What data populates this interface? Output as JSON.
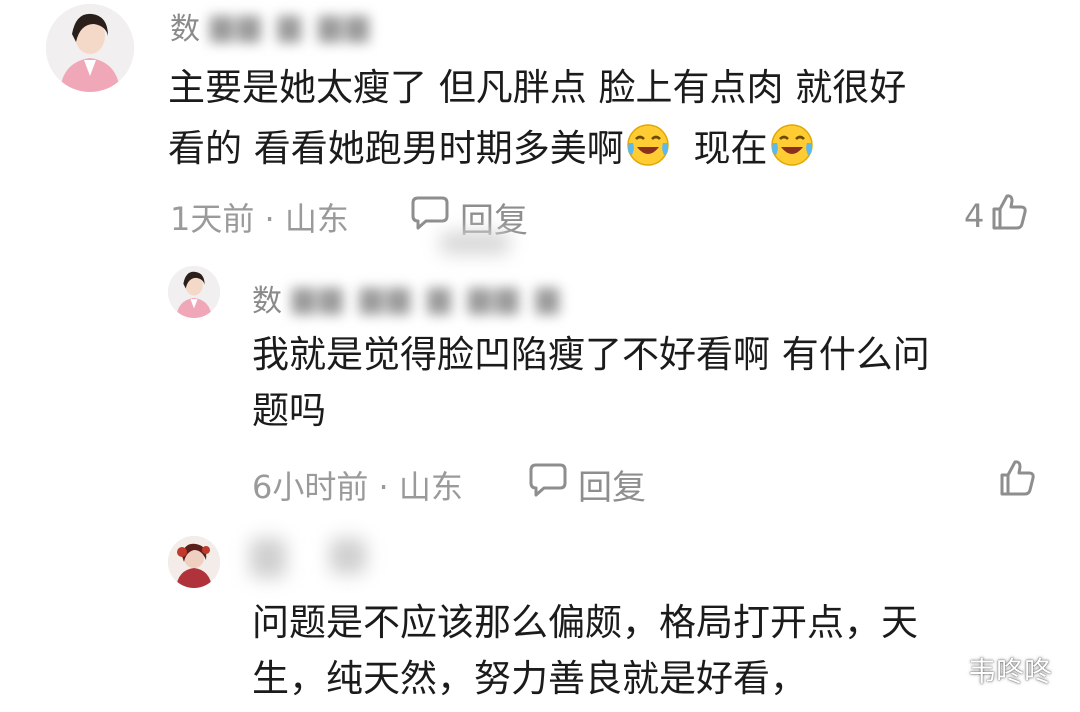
{
  "comments": [
    {
      "username_first_char": "数",
      "text_line1": "主要是她太瘦了 但凡胖点 脸上有点肉 就很好",
      "text_line2a": "看的 看看她跑男时期多美啊",
      "text_line2b": "现在",
      "meta": "1天前 · 山东",
      "reply_label": "回复",
      "like_count": "4"
    },
    {
      "username_first_char": "数",
      "text_line1": "我就是觉得脸凹陷瘦了不好看啊 有什么问",
      "text_line2": "题吗",
      "meta": "6小时前 · 山东",
      "reply_label": "回复",
      "like_count": ""
    },
    {
      "text_line1": "问题是不应该那么偏颇，格局打开点，天",
      "text_line2": "生，纯天然，努力善良就是好看，"
    }
  ],
  "watermark": {
    "text": "韦咚咚"
  },
  "icons": {
    "emoji": "crying-laughing-emoji",
    "reply": "speech-bubble-icon",
    "like": "thumbs-up-icon"
  }
}
